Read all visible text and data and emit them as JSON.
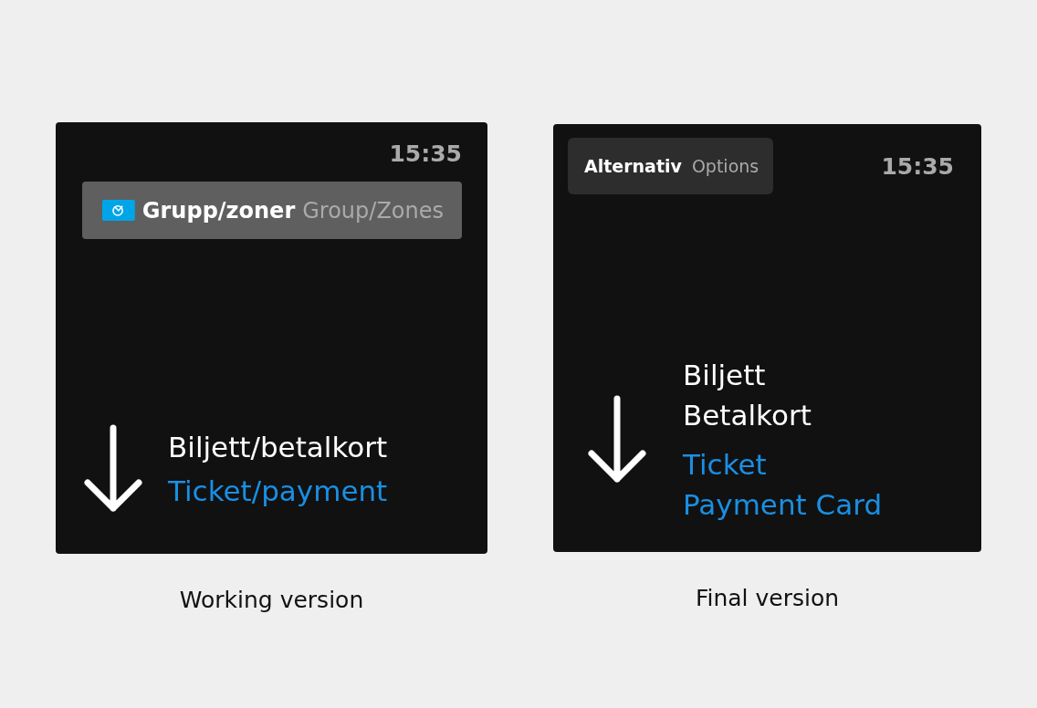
{
  "panels": [
    {
      "kind": "working",
      "time": "15:35",
      "mode_button": {
        "primary": "Grupp/zoner",
        "secondary": "Group/Zones"
      },
      "prompt": {
        "primary": [
          "Biljett/betalkort"
        ],
        "secondary": [
          "Ticket/payment"
        ]
      },
      "caption": "Working version"
    },
    {
      "kind": "final",
      "time": "15:35",
      "mode_button": {
        "primary": "Alternativ",
        "secondary": "Options"
      },
      "prompt": {
        "primary": [
          "Biljett",
          "Betalkort"
        ],
        "secondary": [
          "Ticket",
          "Payment Card"
        ]
      },
      "caption": "Final version"
    }
  ]
}
